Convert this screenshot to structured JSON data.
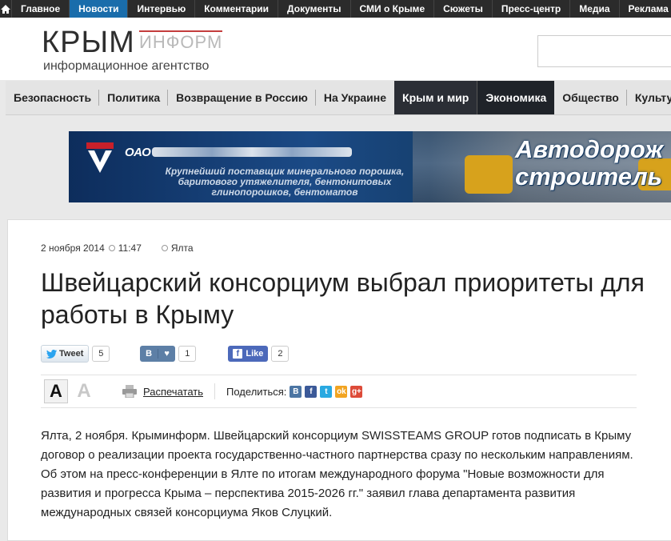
{
  "topnav": {
    "items": [
      "Главное",
      "Новости",
      "Интервью",
      "Комментарии",
      "Документы",
      "СМИ о Крыме",
      "Сюжеты",
      "Пресс-центр",
      "Медиа",
      "Реклама"
    ],
    "active_index": 1,
    "active_color": "#1a6dab"
  },
  "header": {
    "logo_main": "КРЫМ",
    "logo_accent": "ИНФОРМ",
    "logo_subtitle": "информационное агентство"
  },
  "sections": {
    "items": [
      "Безопасность",
      "Политика",
      "Возвращение в Россию",
      "На Украине",
      "Крым и мир",
      "Экономика",
      "Общество",
      "Культура"
    ]
  },
  "banner": {
    "company_prefix": "ОАО",
    "tagline": "Крупнейший поставщик минерального порошка, баритового утяжелителя, бентонитовых глинопорошков, бентоматов",
    "headline_1": "Автодорож",
    "headline_2": "строитель"
  },
  "article": {
    "date": "2 ноября 2014",
    "time": "11:47",
    "location": "Ялта",
    "title": "Швейцарский консорциум выбрал приоритеты для работы в Крыму",
    "share": {
      "tweet_label": "Tweet",
      "tweet_count": "5",
      "vk_label": "В",
      "vk_count": "1",
      "fb_label": "Like",
      "fb_count": "2"
    },
    "tools": {
      "font_large": "А",
      "font_small": "А",
      "print_label": "Распечатать",
      "share_label": "Поделиться:"
    },
    "text": "Ялта, 2 ноября. Крыминформ. Швейцарский консорциум SWISSTEAMS GROUP готов подписать в Крыму договор о реализации проекта государственно-частного партнерства сразу по нескольким направлениям. Об этом на пресс-конференции в Ялте по итогам международного форума \"Новые возможности для развития и прогресса Крыма – перспектива 2015-2026 гг.\" заявил глава департамента развития международных связей консорциума Яков Слуцкий."
  }
}
